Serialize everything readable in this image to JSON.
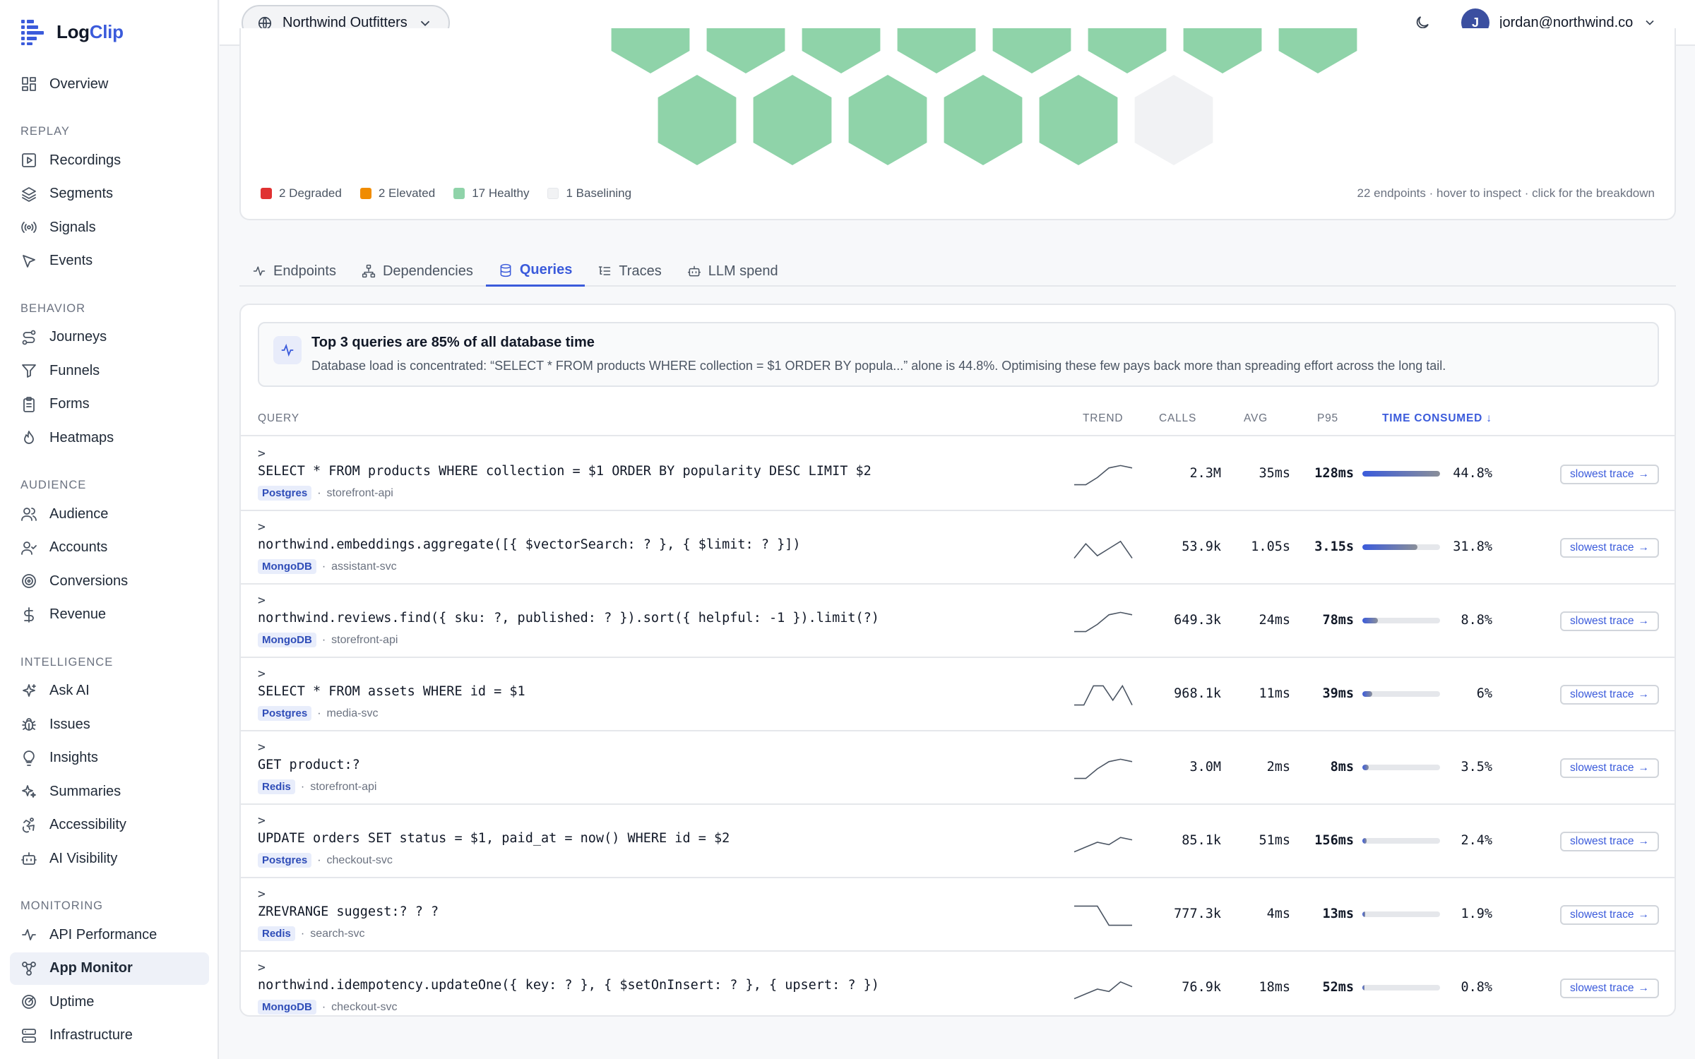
{
  "brand": {
    "name_prefix": "Log",
    "name_accent": "Clip"
  },
  "org": {
    "name": "Northwind Outfitters"
  },
  "user": {
    "initial": "J",
    "email": "jordan@northwind.co"
  },
  "sidebar": {
    "top": [
      {
        "label": "Overview",
        "icon": "grid-icon"
      }
    ],
    "sections": [
      {
        "title": "REPLAY",
        "items": [
          {
            "label": "Recordings",
            "icon": "play-icon"
          },
          {
            "label": "Segments",
            "icon": "layers-icon"
          },
          {
            "label": "Signals",
            "icon": "radio-icon"
          },
          {
            "label": "Events",
            "icon": "cursor-icon"
          }
        ]
      },
      {
        "title": "BEHAVIOR",
        "items": [
          {
            "label": "Journeys",
            "icon": "route-icon"
          },
          {
            "label": "Funnels",
            "icon": "funnel-icon"
          },
          {
            "label": "Forms",
            "icon": "clipboard-icon"
          },
          {
            "label": "Heatmaps",
            "icon": "flame-icon"
          }
        ]
      },
      {
        "title": "AUDIENCE",
        "items": [
          {
            "label": "Audience",
            "icon": "users-icon"
          },
          {
            "label": "Accounts",
            "icon": "user-check-icon"
          },
          {
            "label": "Conversions",
            "icon": "target-icon"
          },
          {
            "label": "Revenue",
            "icon": "dollar-icon"
          }
        ]
      },
      {
        "title": "INTELLIGENCE",
        "items": [
          {
            "label": "Ask AI",
            "icon": "sparkles-icon"
          },
          {
            "label": "Issues",
            "icon": "bug-icon"
          },
          {
            "label": "Insights",
            "icon": "lightbulb-icon"
          },
          {
            "label": "Summaries",
            "icon": "sparkle-icon"
          },
          {
            "label": "Accessibility",
            "icon": "accessibility-icon"
          },
          {
            "label": "AI Visibility",
            "icon": "bot-icon"
          }
        ]
      },
      {
        "title": "MONITORING",
        "items": [
          {
            "label": "API Performance",
            "icon": "activity-icon"
          },
          {
            "label": "App Monitor",
            "icon": "workflow-icon",
            "active": true
          },
          {
            "label": "Uptime",
            "icon": "radar-icon"
          },
          {
            "label": "Infrastructure",
            "icon": "server-icon"
          }
        ]
      }
    ]
  },
  "health": {
    "legend": [
      {
        "label": "2 Degraded",
        "color": "#e03131"
      },
      {
        "label": "2 Elevated",
        "color": "#f08c00"
      },
      {
        "label": "17 Healthy",
        "color": "#8fd3a9"
      },
      {
        "label": "1 Baselining",
        "color": "#f1f2f4"
      }
    ],
    "note": "22 endpoints · hover to inspect · click for the breakdown",
    "hex_colors": {
      "healthy": "#8fd3a9",
      "baselining": "#f1f2f4"
    }
  },
  "tabs": [
    {
      "label": "Endpoints",
      "icon": "activity-icon"
    },
    {
      "label": "Dependencies",
      "icon": "network-icon"
    },
    {
      "label": "Queries",
      "icon": "database-icon",
      "active": true
    },
    {
      "label": "Traces",
      "icon": "list-tree-icon"
    },
    {
      "label": "LLM spend",
      "icon": "bot-icon"
    }
  ],
  "insight": {
    "title": "Top 3 queries are 85% of all database time",
    "desc": "Database load is concentrated: “SELECT * FROM products WHERE collection = $1 ORDER BY popula...” alone is 44.8%. Optimising these few pays back more than spreading effort across the long tail."
  },
  "table": {
    "columns": {
      "query": "QUERY",
      "trend": "TREND",
      "calls": "CALLS",
      "avg": "AVG",
      "p95": "P95",
      "time": "TIME CONSUMED ↓"
    },
    "trace_label": "slowest trace",
    "rows": [
      {
        "query": "SELECT * FROM products WHERE collection = $1 ORDER BY popularity DESC LIMIT $2",
        "db": "Postgres",
        "service": "storefront-api",
        "calls": "2.3M",
        "avg": "35ms",
        "p95": "128ms",
        "pct": "44.8%",
        "share": 0.996,
        "trend": [
          0.1,
          0.1,
          0.4,
          0.8,
          0.9,
          0.8
        ]
      },
      {
        "query": "northwind.embeddings.aggregate([{ $vectorSearch: ? }, { $limit: ? }])",
        "db": "MongoDB",
        "service": "assistant-svc",
        "calls": "53.9k",
        "avg": "1.05s",
        "p95": "3.15s",
        "pct": "31.8%",
        "share": 0.71,
        "trend": [
          0.1,
          0.7,
          0.2,
          0.5,
          0.8,
          0.1
        ]
      },
      {
        "query": "northwind.reviews.find({ sku: ?, published: ? }).sort({ helpful: -1 }).limit(?)",
        "db": "MongoDB",
        "service": "storefront-api",
        "calls": "649.3k",
        "avg": "24ms",
        "p95": "78ms",
        "pct": "8.8%",
        "share": 0.2,
        "trend": [
          0.1,
          0.1,
          0.4,
          0.8,
          0.9,
          0.8
        ]
      },
      {
        "query": "SELECT * FROM assets WHERE id = $1",
        "db": "Postgres",
        "service": "media-svc",
        "calls": "968.1k",
        "avg": "11ms",
        "p95": "39ms",
        "pct": "6%",
        "share": 0.13,
        "trend": [
          0.1,
          0.1,
          0.9,
          0.9,
          0.3,
          0.9,
          0.1
        ]
      },
      {
        "query": "GET product:?",
        "db": "Redis",
        "service": "storefront-api",
        "calls": "3.0M",
        "avg": "2ms",
        "p95": "8ms",
        "pct": "3.5%",
        "share": 0.08,
        "trend": [
          0.1,
          0.1,
          0.5,
          0.8,
          0.9,
          0.8
        ]
      },
      {
        "query": "UPDATE orders SET status = $1, paid_at = now() WHERE id = $2",
        "db": "Postgres",
        "service": "checkout-svc",
        "calls": "85.1k",
        "avg": "51ms",
        "p95": "156ms",
        "pct": "2.4%",
        "share": 0.055,
        "trend": [
          0.1,
          0.3,
          0.5,
          0.4,
          0.7,
          0.6
        ]
      },
      {
        "query": "ZREVRANGE suggest:? ? ?",
        "db": "Redis",
        "service": "search-svc",
        "calls": "777.3k",
        "avg": "4ms",
        "p95": "13ms",
        "pct": "1.9%",
        "share": 0.04,
        "trend": [
          0.9,
          0.9,
          0.9,
          0.1,
          0.1,
          0.1
        ]
      },
      {
        "query": "northwind.idempotency.updateOne({ key: ? }, { $setOnInsert: ? }, { upsert: ? })",
        "db": "MongoDB",
        "service": "checkout-svc",
        "calls": "76.9k",
        "avg": "18ms",
        "p95": "52ms",
        "pct": "0.8%",
        "share": 0.018,
        "trend": [
          0.1,
          0.3,
          0.5,
          0.4,
          0.8,
          0.6
        ]
      }
    ]
  }
}
